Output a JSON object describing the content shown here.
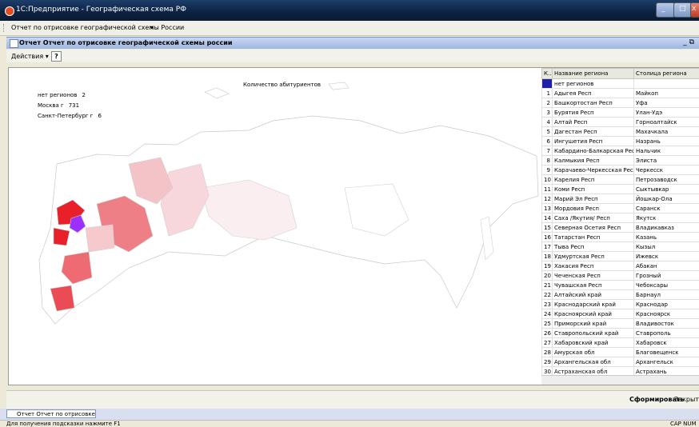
{
  "window": {
    "title": "1С:Предприятие - Географическая схема РФ"
  },
  "menubar": {
    "report_menu": "Отчет по отрисовке географической схемы России",
    "arrow": "▾"
  },
  "doc": {
    "title": "Отчет  Отчет по отрисовке географической схемы россии",
    "controls": "_ ⧉"
  },
  "toolbar": {
    "actions_label": "Действия ▾",
    "help_label": "?"
  },
  "map": {
    "title": "Количество абитуриентов",
    "legend": [
      {
        "label": "нет регионов",
        "value": "2"
      },
      {
        "label": "Москва г",
        "value": "731"
      },
      {
        "label": "Санкт-Петербург г",
        "value": "6"
      }
    ]
  },
  "grid": {
    "columns": [
      "К...",
      "Название региона",
      "Столица региона"
    ],
    "rows": [
      {
        "k": "",
        "name": "нет регионов",
        "capital": ""
      },
      {
        "k": "1",
        "name": "Адыгея Респ",
        "capital": "Майкоп"
      },
      {
        "k": "2",
        "name": "Башкортостан Респ",
        "capital": "Уфа"
      },
      {
        "k": "3",
        "name": "Бурятия Респ",
        "capital": "Улан-Удэ"
      },
      {
        "k": "4",
        "name": "Алтай Респ",
        "capital": "Горноалтайск"
      },
      {
        "k": "5",
        "name": "Дагестан Респ",
        "capital": "Махачкала"
      },
      {
        "k": "6",
        "name": "Ингушетия Респ",
        "capital": "Назрань"
      },
      {
        "k": "7",
        "name": "Кабардино-Балкарская Респ",
        "capital": "Нальчик"
      },
      {
        "k": "8",
        "name": "Калмыкия Респ",
        "capital": "Элиста"
      },
      {
        "k": "9",
        "name": "Карачаево-Черкесская Респ",
        "capital": "Черкесск"
      },
      {
        "k": "10",
        "name": "Карелия Респ",
        "capital": "Петрозаводск"
      },
      {
        "k": "11",
        "name": "Коми Респ",
        "capital": "Сыктывкар"
      },
      {
        "k": "12",
        "name": "Марий Эл Респ",
        "capital": "Йошкар-Ола"
      },
      {
        "k": "13",
        "name": "Мордовия Респ",
        "capital": "Саранск"
      },
      {
        "k": "14",
        "name": "Саха /Якутия/ Респ",
        "capital": "Якутск"
      },
      {
        "k": "15",
        "name": "Северная Осетия Респ",
        "capital": "Владикавказ"
      },
      {
        "k": "16",
        "name": "Татарстан Респ",
        "capital": "Казань"
      },
      {
        "k": "17",
        "name": "Тыва Респ",
        "capital": "Кызыл"
      },
      {
        "k": "18",
        "name": "Удмуртская Респ",
        "capital": "Ижевск"
      },
      {
        "k": "19",
        "name": "Хакасия Респ",
        "capital": "Абакан"
      },
      {
        "k": "20",
        "name": "Чеченская Респ",
        "capital": "Грозный"
      },
      {
        "k": "21",
        "name": "Чувашская Респ",
        "capital": "Чебоксары"
      },
      {
        "k": "22",
        "name": "Алтайский край",
        "capital": "Барнаул"
      },
      {
        "k": "23",
        "name": "Краснодарский край",
        "capital": "Краснодар"
      },
      {
        "k": "24",
        "name": "Красноярский край",
        "capital": "Красноярск"
      },
      {
        "k": "25",
        "name": "Приморский край",
        "capital": "Владивосток"
      },
      {
        "k": "26",
        "name": "Ставропольский край",
        "capital": "Ставрополь"
      },
      {
        "k": "27",
        "name": "Хабаровский край",
        "capital": "Хабаровск"
      },
      {
        "k": "28",
        "name": "Амурская обл",
        "capital": "Благовещенск"
      },
      {
        "k": "29",
        "name": "Архангельская обл",
        "capital": "Архангельск"
      },
      {
        "k": "30",
        "name": "Астраханская обл",
        "capital": "Астрахань"
      }
    ]
  },
  "bottom": {
    "form_label": "Сформировать",
    "close_label": "Закрыть"
  },
  "taskbar": {
    "item": "Отчет  Отчет по отрисовке ..."
  },
  "status": {
    "text": "Для получения подсказки нажмите F1",
    "cap": "CAP  NUM"
  },
  "colors": {
    "no_regions": "#1f1fa8",
    "moscow": "#9b30ff",
    "max_red": "#e8202a"
  }
}
